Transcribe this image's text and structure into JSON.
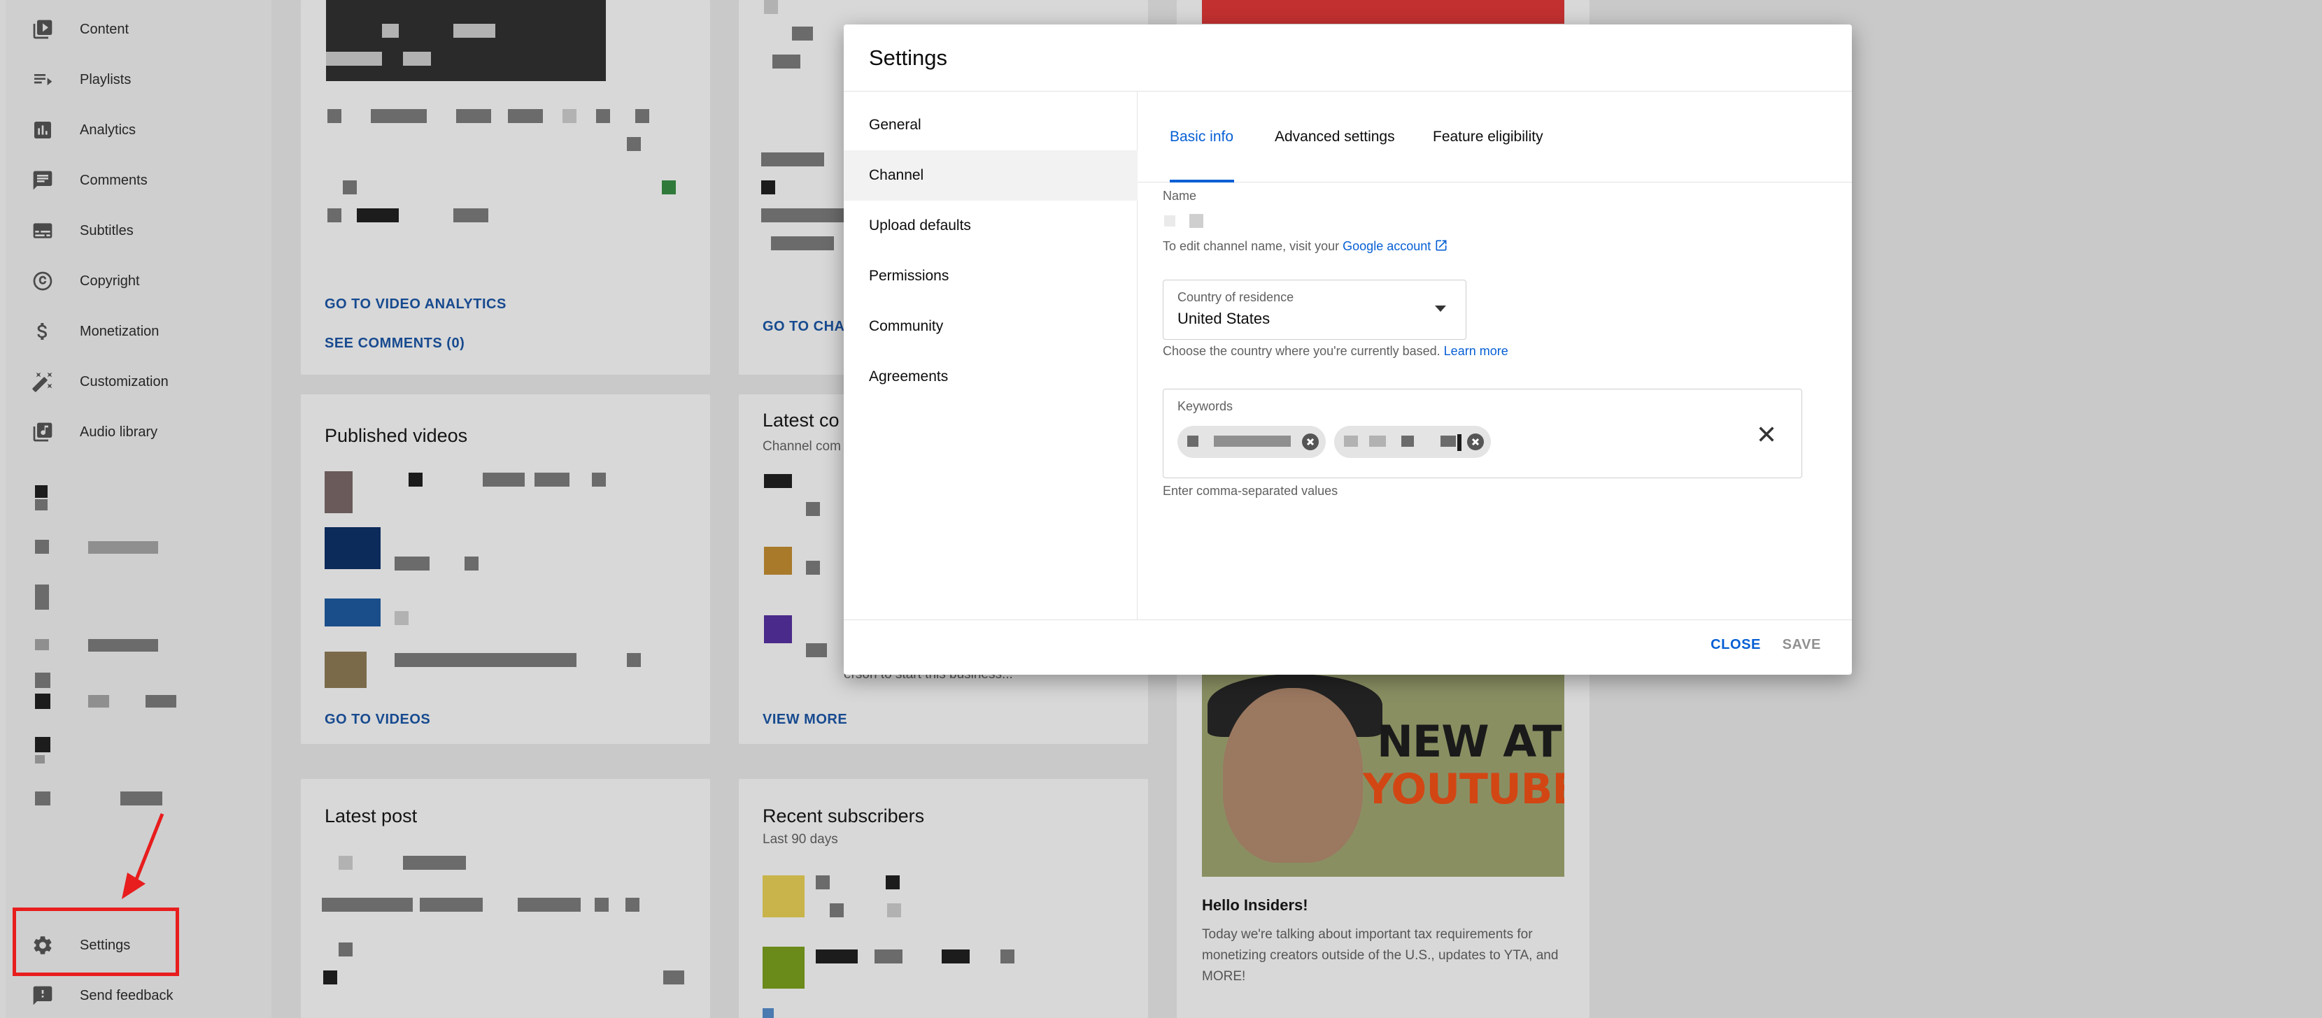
{
  "sidebar": {
    "items": [
      {
        "label": "Content",
        "icon": "content-icon"
      },
      {
        "label": "Playlists",
        "icon": "playlists-icon"
      },
      {
        "label": "Analytics",
        "icon": "analytics-icon"
      },
      {
        "label": "Comments",
        "icon": "comments-icon"
      },
      {
        "label": "Subtitles",
        "icon": "subtitles-icon"
      },
      {
        "label": "Copyright",
        "icon": "copyright-icon"
      },
      {
        "label": "Monetization",
        "icon": "dollar-icon"
      },
      {
        "label": "Customization",
        "icon": "wand-icon"
      },
      {
        "label": "Audio library",
        "icon": "audio-library-icon"
      }
    ],
    "settings_label": "Settings",
    "feedback_label": "Send feedback"
  },
  "background": {
    "video_analytics_link": "GO TO VIDEO ANALYTICS",
    "see_comments_link": "SEE COMMENTS (0)",
    "go_to_channel_link": "GO TO CHAN",
    "published_videos_title": "Published videos",
    "go_to_videos_link": "GO TO VIDEOS",
    "latest_comments_title": "Latest co",
    "latest_comments_sub": "Channel com",
    "view_more_link": "VIEW MORE",
    "latest_post_title": "Latest post",
    "recent_subscribers_title": "Recent subscribers",
    "recent_subscribers_sub": "Last 90 days",
    "news_title": "Hello Insiders!",
    "news_body": "Today we're talking about important tax requirements for monetizing creators outside of the U.S., updates to YTA, and MORE!",
    "thumb_text_1": "NEW AT",
    "thumb_text_2": "YOUTUBE",
    "hidden_text": "erson to start this business..."
  },
  "modal": {
    "title": "Settings",
    "nav": [
      "General",
      "Channel",
      "Upload defaults",
      "Permissions",
      "Community",
      "Agreements"
    ],
    "active_nav": "Channel",
    "tabs": [
      "Basic info",
      "Advanced settings",
      "Feature eligibility"
    ],
    "active_tab": "Basic info",
    "name_label": "Name",
    "name_helper": "To edit channel name, visit your",
    "name_helper_link": "Google account",
    "country_label": "Country of residence",
    "country_value": "United States",
    "country_helper": "Choose the country where you're currently based.",
    "country_helper_link": "Learn more",
    "keywords_label": "Keywords",
    "keywords_helper": "Enter comma-separated values",
    "close_button": "CLOSE",
    "save_button": "SAVE"
  },
  "colors": {
    "accent": "#065fd4",
    "highlight": "#e81d1d"
  }
}
